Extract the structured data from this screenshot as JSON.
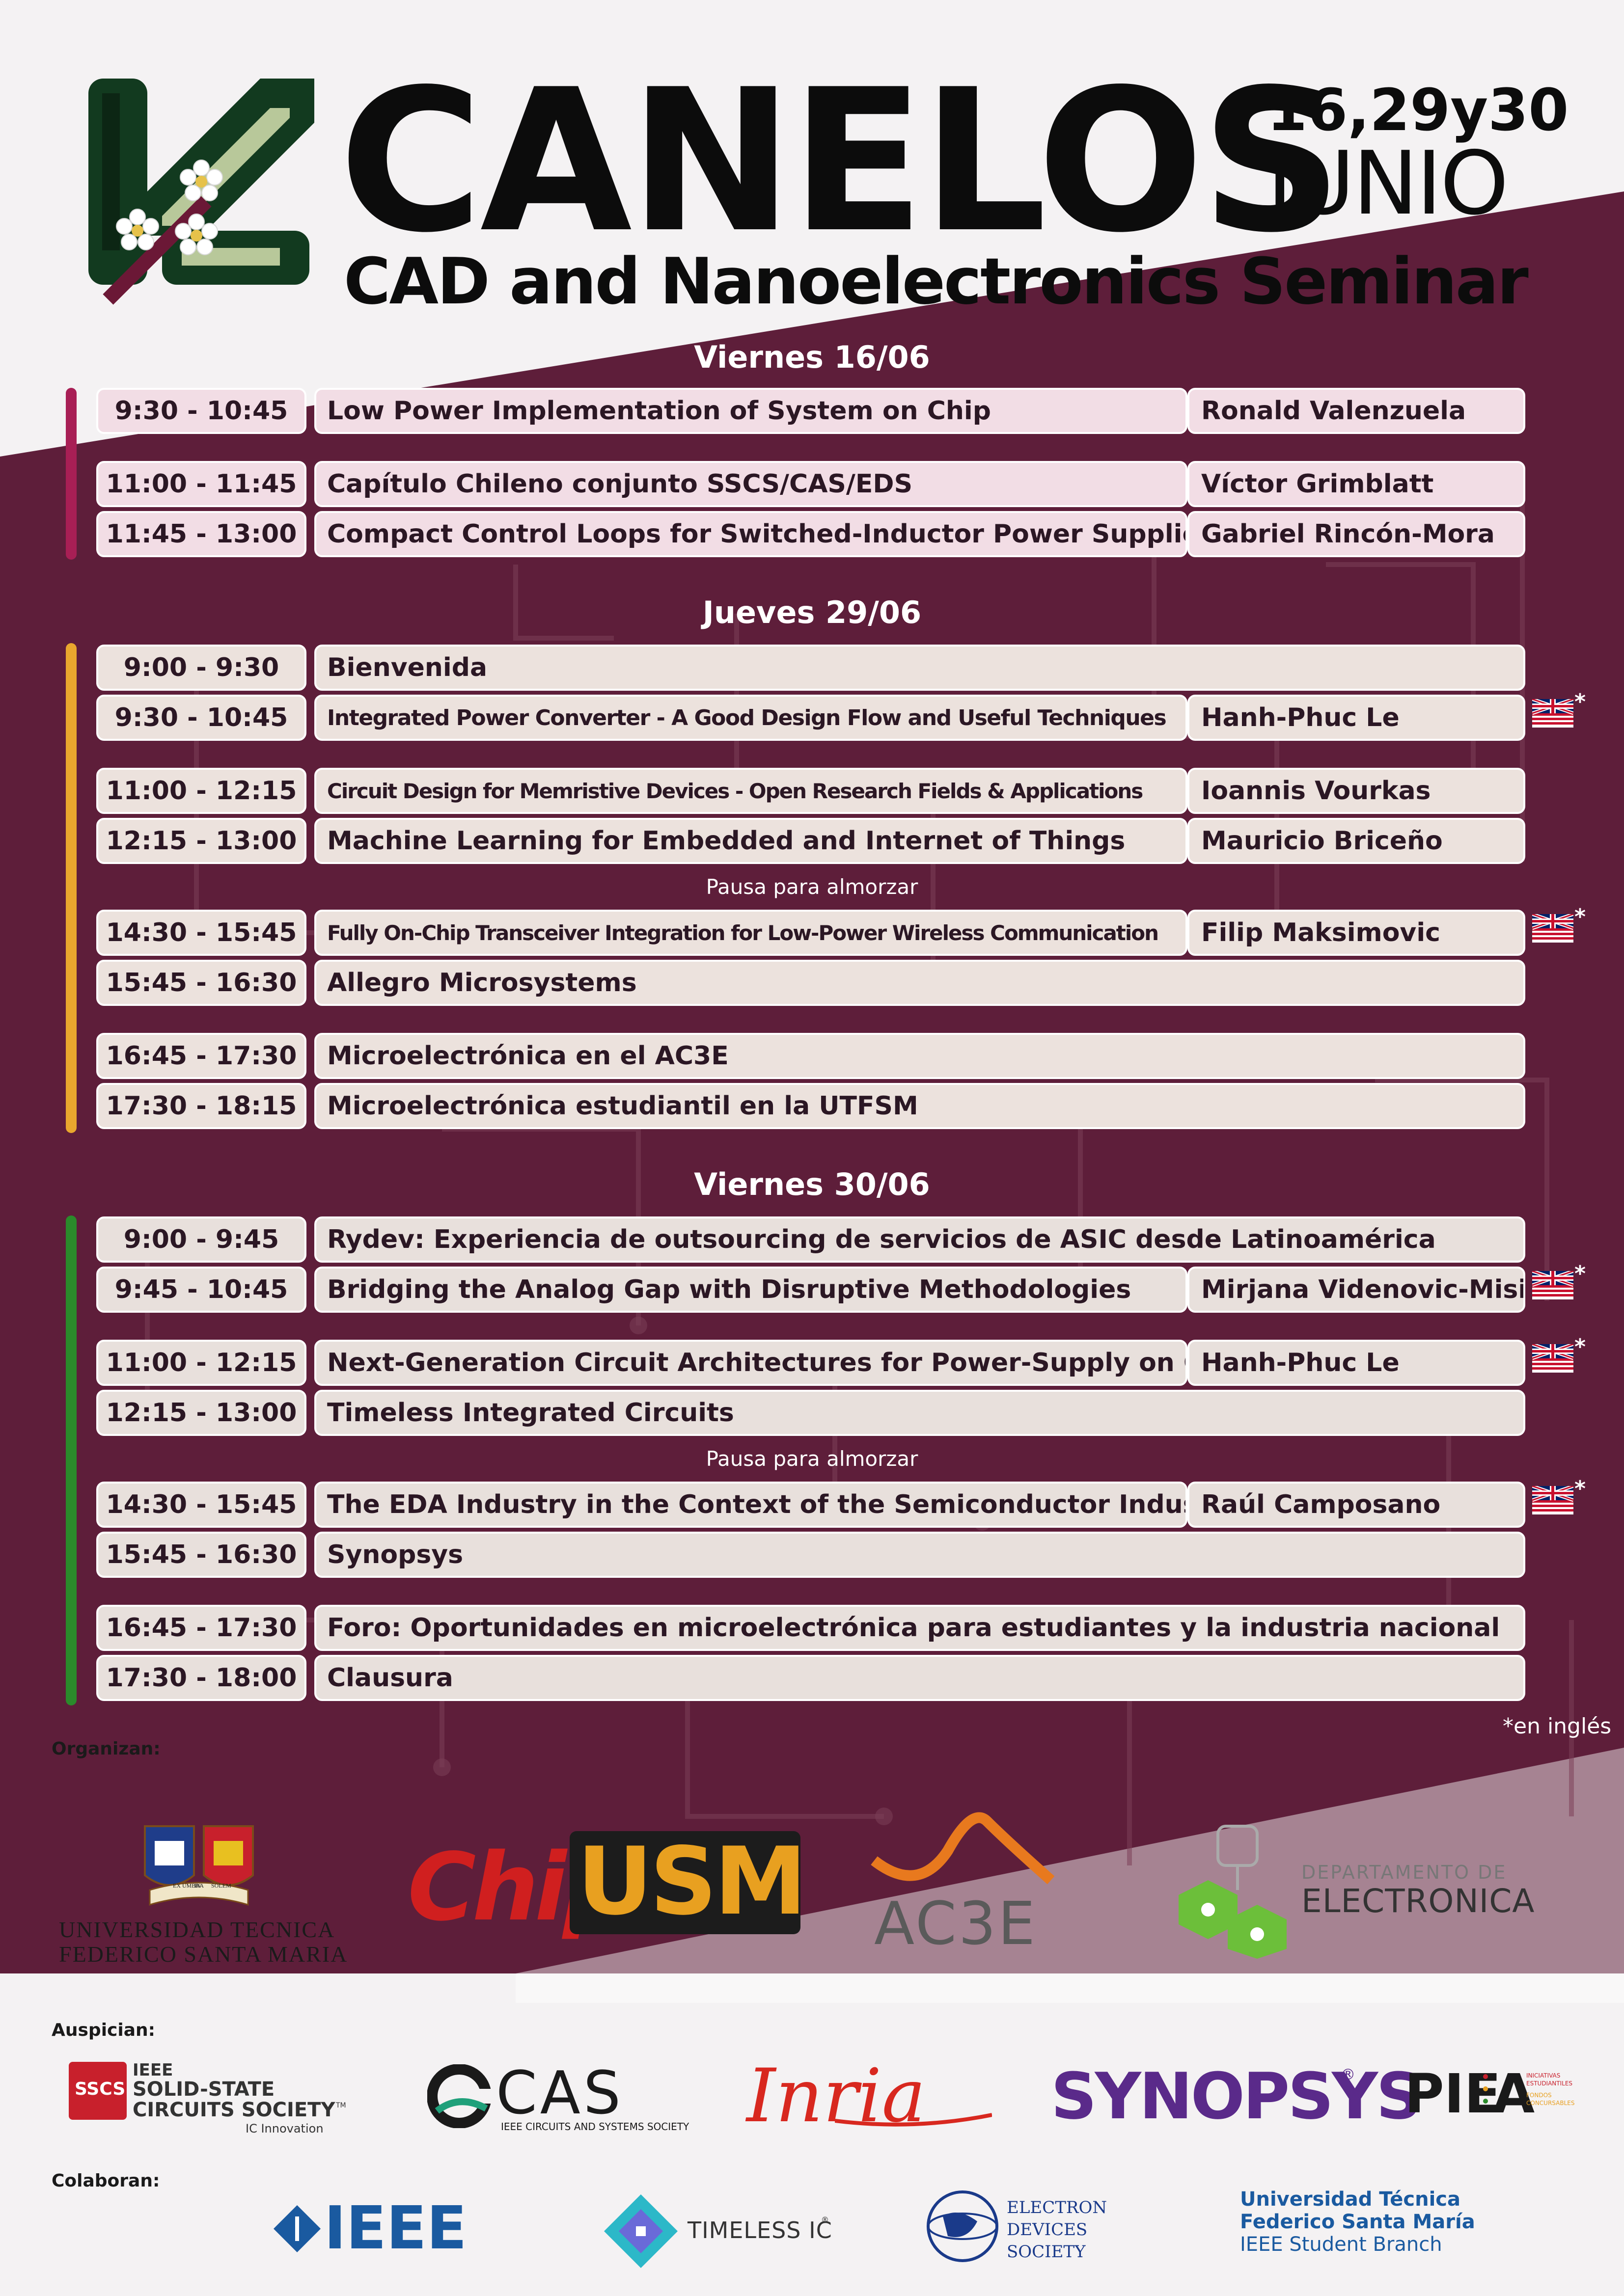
{
  "header": {
    "title": "CANELOS",
    "dates": "16,29y30",
    "month": "JUNIO",
    "subtitle": "CAD and Nanoelectronics Seminar"
  },
  "days": [
    {
      "title": "Viernes 16/06",
      "sessions": [
        {
          "time": "9:30 - 10:45",
          "title": "Low Power Implementation of System on Chip",
          "speaker": "Ronald Valenzuela"
        },
        {
          "time": "11:00 - 11:45",
          "title": "Capítulo Chileno conjunto SSCS/CAS/EDS",
          "speaker": "Víctor Grimblatt"
        },
        {
          "time": "11:45 - 13:00",
          "title": "Compact Control Loops for Switched-Inductor Power Supplies",
          "speaker": "Gabriel Rincón-Mora"
        }
      ]
    },
    {
      "title": "Jueves 29/06",
      "sessions": [
        {
          "time": "9:00 - 9:30",
          "title": "Bienvenida"
        },
        {
          "time": "9:30 - 10:45",
          "title": "Integrated Power Converter - A Good Design Flow and Useful Techniques",
          "speaker": "Hanh-Phuc Le"
        },
        {
          "time": "11:00 - 12:15",
          "title": "Circuit Design for Memristive Devices - Open Research Fields & Applications",
          "speaker": "Ioannis Vourkas"
        },
        {
          "time": "12:15 - 13:00",
          "title": "Machine Learning for Embedded and Internet of Things",
          "speaker": "Mauricio Briceño"
        },
        {
          "time": "14:30 - 15:45",
          "title": "Fully On-Chip Transceiver Integration for Low-Power Wireless Communication",
          "speaker": "Filip Maksimovic"
        },
        {
          "time": "15:45 - 16:30",
          "title": "Allegro Microsystems"
        },
        {
          "time": "16:45 - 17:30",
          "title": "Microelectrónica en el AC3E"
        },
        {
          "time": "17:30 - 18:15",
          "title": "Microelectrónica estudiantil en la UTFSM"
        }
      ],
      "break": "Pausa para almorzar"
    },
    {
      "title": "Viernes 30/06",
      "sessions": [
        {
          "time": "9:00 - 9:45",
          "title": "Rydev: Experiencia de outsourcing de servicios de ASIC desde Latinoamérica"
        },
        {
          "time": "9:45 - 10:45",
          "title": "Bridging the Analog Gap with Disruptive Methodologies",
          "speaker": "Mirjana Videnovic-Misic"
        },
        {
          "time": "11:00 - 12:15",
          "title": "Next-Generation Circuit Architectures for Power-Supply on Chip",
          "speaker": "Hanh-Phuc Le"
        },
        {
          "time": "12:15 - 13:00",
          "title": "Timeless Integrated Circuits"
        },
        {
          "time": "14:30 - 15:45",
          "title": "The EDA Industry in the Context of the Semiconductor Industry",
          "speaker": "Raúl Camposano"
        },
        {
          "time": "15:45 - 16:30",
          "title": "Synopsys"
        },
        {
          "time": "16:45 - 17:30",
          "title": "Foro: Oportunidades en microelectrónica para estudiantes y la industria nacional"
        },
        {
          "time": "17:30 - 18:00",
          "title": "Clausura"
        }
      ],
      "break": "Pausa para almorzar"
    }
  ],
  "english_note": "*en inglés",
  "asterisk": "*",
  "organizers": {
    "label": "Organizan:",
    "utfsm_line1": "UNIVERSIDAD TECNICA",
    "utfsm_line2": "FEDERICO SANTA MARIA",
    "utfsm_ribbon_left": "EX UMBRA",
    "utfsm_ribbon_center": "IN",
    "utfsm_ribbon_right": "SOLEM",
    "chip": "Chip",
    "usm": "USM",
    "ac3e": "AC3E",
    "depto_line1": "DEPARTAMENTO DE",
    "depto_line2": "ELECTRONICA"
  },
  "sponsors": {
    "label": "Auspician:",
    "sscs_badge": "SSCS",
    "sscs_line1": "IEEE",
    "sscs_line2": "SOLID-STATE",
    "sscs_line3": "CIRCUITS SOCIETY",
    "sscs_tm": "TM",
    "sscs_sub": "IC Innovation",
    "cas": "CAS",
    "cas_sub": "IEEE CIRCUITS AND SYSTEMS SOCIETY",
    "inria": "Inria",
    "synopsys": "SYNOPSYS",
    "synopsys_mark": "®",
    "pie": "PIE",
    "pie_a": "A",
    "pie_sub1": "INICIATIVAS",
    "pie_sub2": "ESTUDIANTILES",
    "pie_sub3": "FONDOS",
    "pie_sub4": "CONCURSABLES"
  },
  "collaborators": {
    "label": "Colaboran:",
    "ieee": "IEEE",
    "timeless": "TIMELESS IC",
    "timeless_mark": "®",
    "eds_line1": "ELECTRON",
    "eds_line2": "DEVICES",
    "eds_line3": "SOCIETY",
    "utfsm_sb_line1": "Universidad Técnica",
    "utfsm_sb_line2": "Federico Santa María",
    "utfsm_sb_line3": "IEEE Student Branch"
  },
  "colors": {
    "maroon": "#5e1e3a",
    "day1_bar": "#a81f55",
    "day2_bar": "#e9a72e",
    "day3_bar": "#2b8a2b",
    "day1_cells": "#f2dde5",
    "day2_cells": "#ece2dd",
    "day3_cells": "#e8e0dc"
  }
}
